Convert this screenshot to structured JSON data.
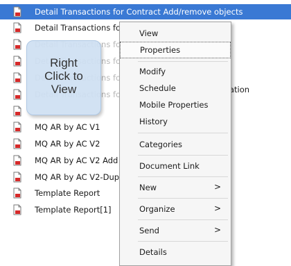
{
  "list": {
    "rows": [
      {
        "text": "Detail Transactions for Contract Add/remove objects",
        "selected": true
      },
      {
        "text": "Detail Transactions fo"
      },
      {
        "text": "Detail Transactions fo"
      },
      {
        "text": "Detail Transactions fo"
      },
      {
        "text": "Detail Transactions fo"
      },
      {
        "text": "Detail Transactions fo"
      },
      {
        "text": "MQ AR by AC V1"
      },
      {
        "text": "MQ AR by AC V2"
      },
      {
        "text": "MQ AR by AC V2 Add"
      },
      {
        "text": "MQ AR by AC V2-Dup"
      },
      {
        "text": "Template Report"
      },
      {
        "text": "Template Report[1]"
      }
    ],
    "overflow_text": "ation"
  },
  "callout": {
    "text": "Right\nClick to\nView"
  },
  "context_menu": {
    "items": [
      {
        "label": "View"
      },
      {
        "label": "Properties",
        "focused": true
      },
      {
        "label": "Modify"
      },
      {
        "label": "Schedule"
      },
      {
        "label": "Mobile Properties"
      },
      {
        "label": "History"
      },
      {
        "label": "Categories"
      },
      {
        "label": "Document Link"
      },
      {
        "label": "New",
        "arrow": ">"
      },
      {
        "label": "Organize",
        "arrow": ">"
      },
      {
        "label": "Send",
        "arrow": ">"
      },
      {
        "label": "Details"
      }
    ]
  },
  "colors": {
    "selection": "#3a79d4",
    "callout_bg": "#cfe0f3",
    "menu_bg": "#f6f6f6"
  },
  "icons": {
    "row_icon": "document-report-icon",
    "submenu_icon": "chevron-right-icon"
  }
}
